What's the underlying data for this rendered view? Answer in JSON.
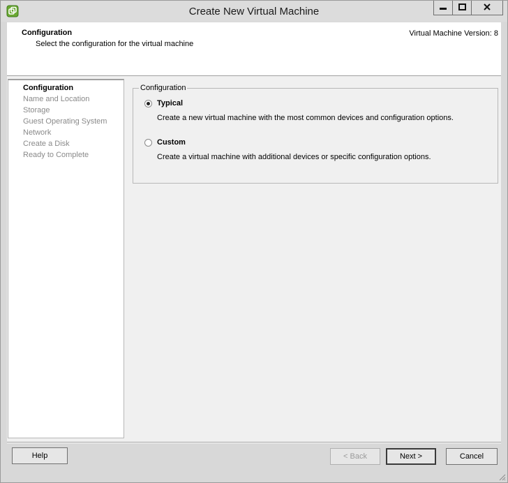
{
  "window": {
    "title": "Create New Virtual Machine",
    "controls": [
      "minimize-icon",
      "maximize-icon",
      "close-icon"
    ]
  },
  "header": {
    "title": "Configuration",
    "subtitle": "Select the configuration for the virtual machine",
    "version": "Virtual Machine Version: 8"
  },
  "steps": [
    {
      "label": "Configuration",
      "active": true
    },
    {
      "label": "Name and Location",
      "active": false
    },
    {
      "label": "Storage",
      "active": false
    },
    {
      "label": "Guest Operating System",
      "active": false
    },
    {
      "label": "Network",
      "active": false
    },
    {
      "label": "Create a Disk",
      "active": false
    },
    {
      "label": "Ready to Complete",
      "active": false
    }
  ],
  "configuration": {
    "legend": "Configuration",
    "selected": "typical",
    "options": [
      {
        "id": "typical",
        "label": "Typical",
        "description": "Create a new virtual machine with the most common devices and configuration options."
      },
      {
        "id": "custom",
        "label": "Custom",
        "description": "Create a virtual machine with additional devices or specific configuration options."
      }
    ]
  },
  "buttons": {
    "help": "Help",
    "back": "< Back",
    "next": "Next >",
    "cancel": "Cancel"
  },
  "colors": {
    "accent_green": "#5a9a2e",
    "window_bg": "#d8d8d8",
    "panel_bg": "#f0f0f0"
  }
}
